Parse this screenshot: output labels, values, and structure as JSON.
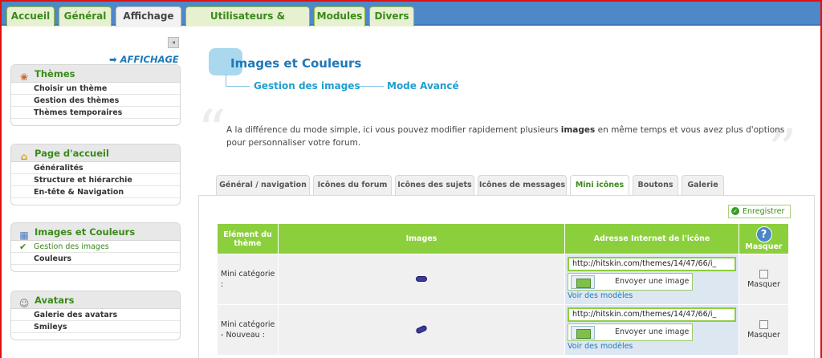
{
  "top_tabs": [
    "Accueil",
    "Général",
    "Affichage",
    "Utilisateurs & Groupes",
    "Modules",
    "Divers"
  ],
  "sidebar": {
    "collapse_icon": "◂",
    "section_link": "➡ AFFICHAGE",
    "boxes": [
      {
        "title": "Thèmes",
        "icon": "themes-icon",
        "items": [
          "Choisir un thème",
          "Gestion des thèmes",
          "Thèmes temporaires"
        ]
      },
      {
        "title": "Page d'accueil",
        "icon": "home-icon",
        "items": [
          "Généralités",
          "Structure et hiérarchie",
          "En-tête & Navigation"
        ]
      },
      {
        "title": "Images et Couleurs",
        "icon": "images-icon",
        "items": [
          "Gestion des images",
          "Couleurs"
        ],
        "selected": 0
      },
      {
        "title": "Avatars",
        "icon": "avatar-icon",
        "items": [
          "Galerie des avatars",
          "Smileys"
        ]
      }
    ]
  },
  "header": {
    "title": "Images et Couleurs",
    "crumb1": "Gestion des images",
    "crumb2": "Mode Avancé"
  },
  "intro": {
    "part1": "A la différence du mode simple, ici vous pouvez modifier rapidement plusieurs ",
    "bold": "images",
    "part2": " en même temps et vous avez plus d'options pour personnaliser votre forum."
  },
  "sub_tabs": [
    "Général / navigation",
    "Icônes du forum",
    "Icônes des sujets",
    "Icônes de messages",
    "Mini icônes",
    "Boutons",
    "Galerie"
  ],
  "save_label": "Enregistrer",
  "table": {
    "headers": {
      "element": "Elément du thème",
      "images": "Images",
      "url": "Adresse Internet de l'icône",
      "hide": "Masquer",
      "help": "?"
    },
    "rows": [
      {
        "name": "Mini catégorie :",
        "url": "http://hitskin.com/themes/14/47/66/i_",
        "upload": "Envoyer une image",
        "models": "Voir des modèles",
        "hide": "Masquer"
      },
      {
        "name": "Mini catégorie - Nouveau :",
        "url": "http://hitskin.com/themes/14/47/66/i_",
        "upload": "Envoyer une image",
        "models": "Voir des modèles",
        "hide": "Masquer"
      }
    ]
  },
  "colors": {
    "accent_green": "#8ccf3c",
    "link_blue": "#1f78b8",
    "top_bar": "#4f88c9"
  }
}
